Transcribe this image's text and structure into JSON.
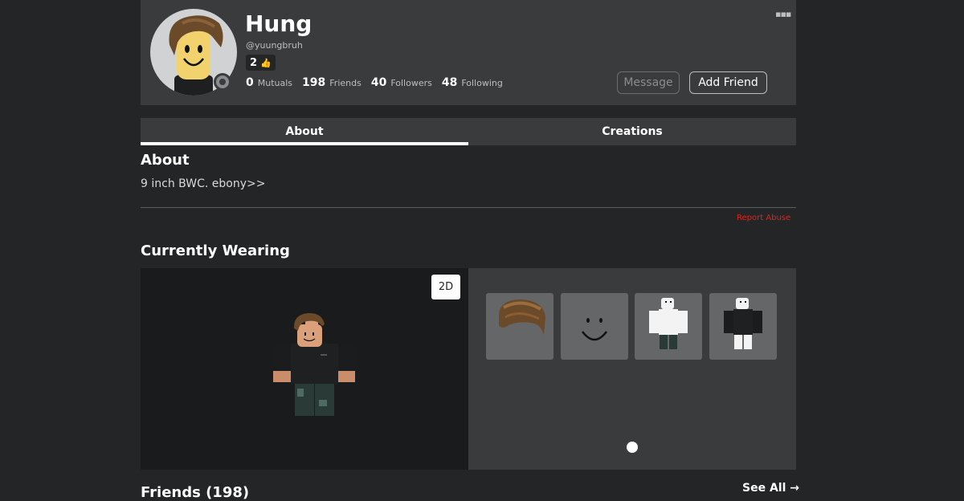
{
  "profile": {
    "display_name": "Hung",
    "username": "@yuungbruh",
    "badge_count": "2",
    "badge_icon": "thumbs-up-icon",
    "stats": [
      {
        "num": "0",
        "label": "Mutuals"
      },
      {
        "num": "198",
        "label": "Friends"
      },
      {
        "num": "40",
        "label": "Followers"
      },
      {
        "num": "48",
        "label": "Following"
      }
    ],
    "message_label": "Message",
    "add_friend_label": "Add Friend",
    "more_icon": "more-dots-icon"
  },
  "tabs": [
    {
      "label": "About",
      "active": true
    },
    {
      "label": "Creations",
      "active": false
    }
  ],
  "about": {
    "title": "About",
    "text": "9 inch BWC. ebony>>",
    "report_label": "Report Abuse"
  },
  "wearing": {
    "title": "Currently Wearing",
    "toggle_label": "2D",
    "items": [
      "hair-item",
      "face-item",
      "shirt-item",
      "outfit-item"
    ]
  },
  "friends": {
    "title": "Friends (198)",
    "see_all_label": "See All →"
  },
  "colors": {
    "background": "#232527",
    "card": "#393b3d",
    "report": "#e2231a"
  }
}
